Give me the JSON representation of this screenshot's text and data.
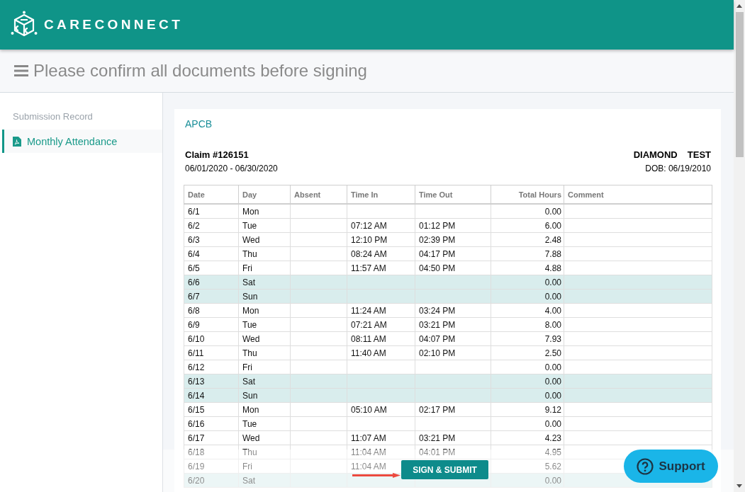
{
  "header": {
    "brand": "CARECONNECT"
  },
  "page_title": "Please confirm all documents before signing",
  "sidebar": {
    "heading": "Submission Record",
    "items": [
      {
        "label": "Monthly Attendance",
        "selected": true
      }
    ]
  },
  "document": {
    "agency": "APCB",
    "claim": "Claim #126151",
    "period": "06/01/2020 - 06/30/2020",
    "name": [
      "DIAMOND",
      "TEST"
    ],
    "dob": "DOB: 06/19/2010",
    "table": {
      "columns": [
        "Date",
        "Day",
        "Absent",
        "Time In",
        "Time Out",
        "Total Hours",
        "Comment"
      ],
      "rows": [
        {
          "date": "6/1",
          "day": "Mon",
          "total_hours": "0.00",
          "weekend": false
        },
        {
          "date": "6/2",
          "day": "Tue",
          "time_in": "07:12 AM",
          "time_out": "01:12 PM",
          "total_hours": "6.00",
          "weekend": false
        },
        {
          "date": "6/3",
          "day": "Wed",
          "time_in": "12:10 PM",
          "time_out": "02:39 PM",
          "total_hours": "2.48",
          "weekend": false
        },
        {
          "date": "6/4",
          "day": "Thu",
          "time_in": "08:24 AM",
          "time_out": "04:17 PM",
          "total_hours": "7.88",
          "weekend": false
        },
        {
          "date": "6/5",
          "day": "Fri",
          "time_in": "11:57 AM",
          "time_out": "04:50 PM",
          "total_hours": "4.88",
          "weekend": false
        },
        {
          "date": "6/6",
          "day": "Sat",
          "total_hours": "0.00",
          "weekend": true
        },
        {
          "date": "6/7",
          "day": "Sun",
          "total_hours": "0.00",
          "weekend": true
        },
        {
          "date": "6/8",
          "day": "Mon",
          "time_in": "11:24 AM",
          "time_out": "03:24 PM",
          "total_hours": "4.00",
          "weekend": false
        },
        {
          "date": "6/9",
          "day": "Tue",
          "time_in": "07:21 AM",
          "time_out": "03:21 PM",
          "total_hours": "8.00",
          "weekend": false
        },
        {
          "date": "6/10",
          "day": "Wed",
          "time_in": "08:11 AM",
          "time_out": "04:07 PM",
          "total_hours": "7.93",
          "weekend": false
        },
        {
          "date": "6/11",
          "day": "Thu",
          "time_in": "11:40 AM",
          "time_out": "02:10 PM",
          "total_hours": "2.50",
          "weekend": false
        },
        {
          "date": "6/12",
          "day": "Fri",
          "total_hours": "0.00",
          "weekend": false
        },
        {
          "date": "6/13",
          "day": "Sat",
          "total_hours": "0.00",
          "weekend": true
        },
        {
          "date": "6/14",
          "day": "Sun",
          "total_hours": "0.00",
          "weekend": true
        },
        {
          "date": "6/15",
          "day": "Mon",
          "time_in": "05:10 AM",
          "time_out": "02:17 PM",
          "total_hours": "9.12",
          "weekend": false
        },
        {
          "date": "6/16",
          "day": "Tue",
          "total_hours": "0.00",
          "weekend": false
        },
        {
          "date": "6/17",
          "day": "Wed",
          "time_in": "11:07 AM",
          "time_out": "03:21 PM",
          "total_hours": "4.23",
          "weekend": false
        },
        {
          "date": "6/18",
          "day": "Thu",
          "time_in": "11:04 AM",
          "time_out": "04:01 PM",
          "total_hours": "4.95",
          "weekend": false
        },
        {
          "date": "6/19",
          "day": "Fri",
          "time_in": "11:04 AM",
          "total_hours": "5.62",
          "weekend": false
        },
        {
          "date": "6/20",
          "day": "Sat",
          "total_hours": "0.00",
          "weekend": true
        }
      ]
    }
  },
  "footer": {
    "submit_button": "SIGN & SUBMIT",
    "support_button": "Support"
  }
}
